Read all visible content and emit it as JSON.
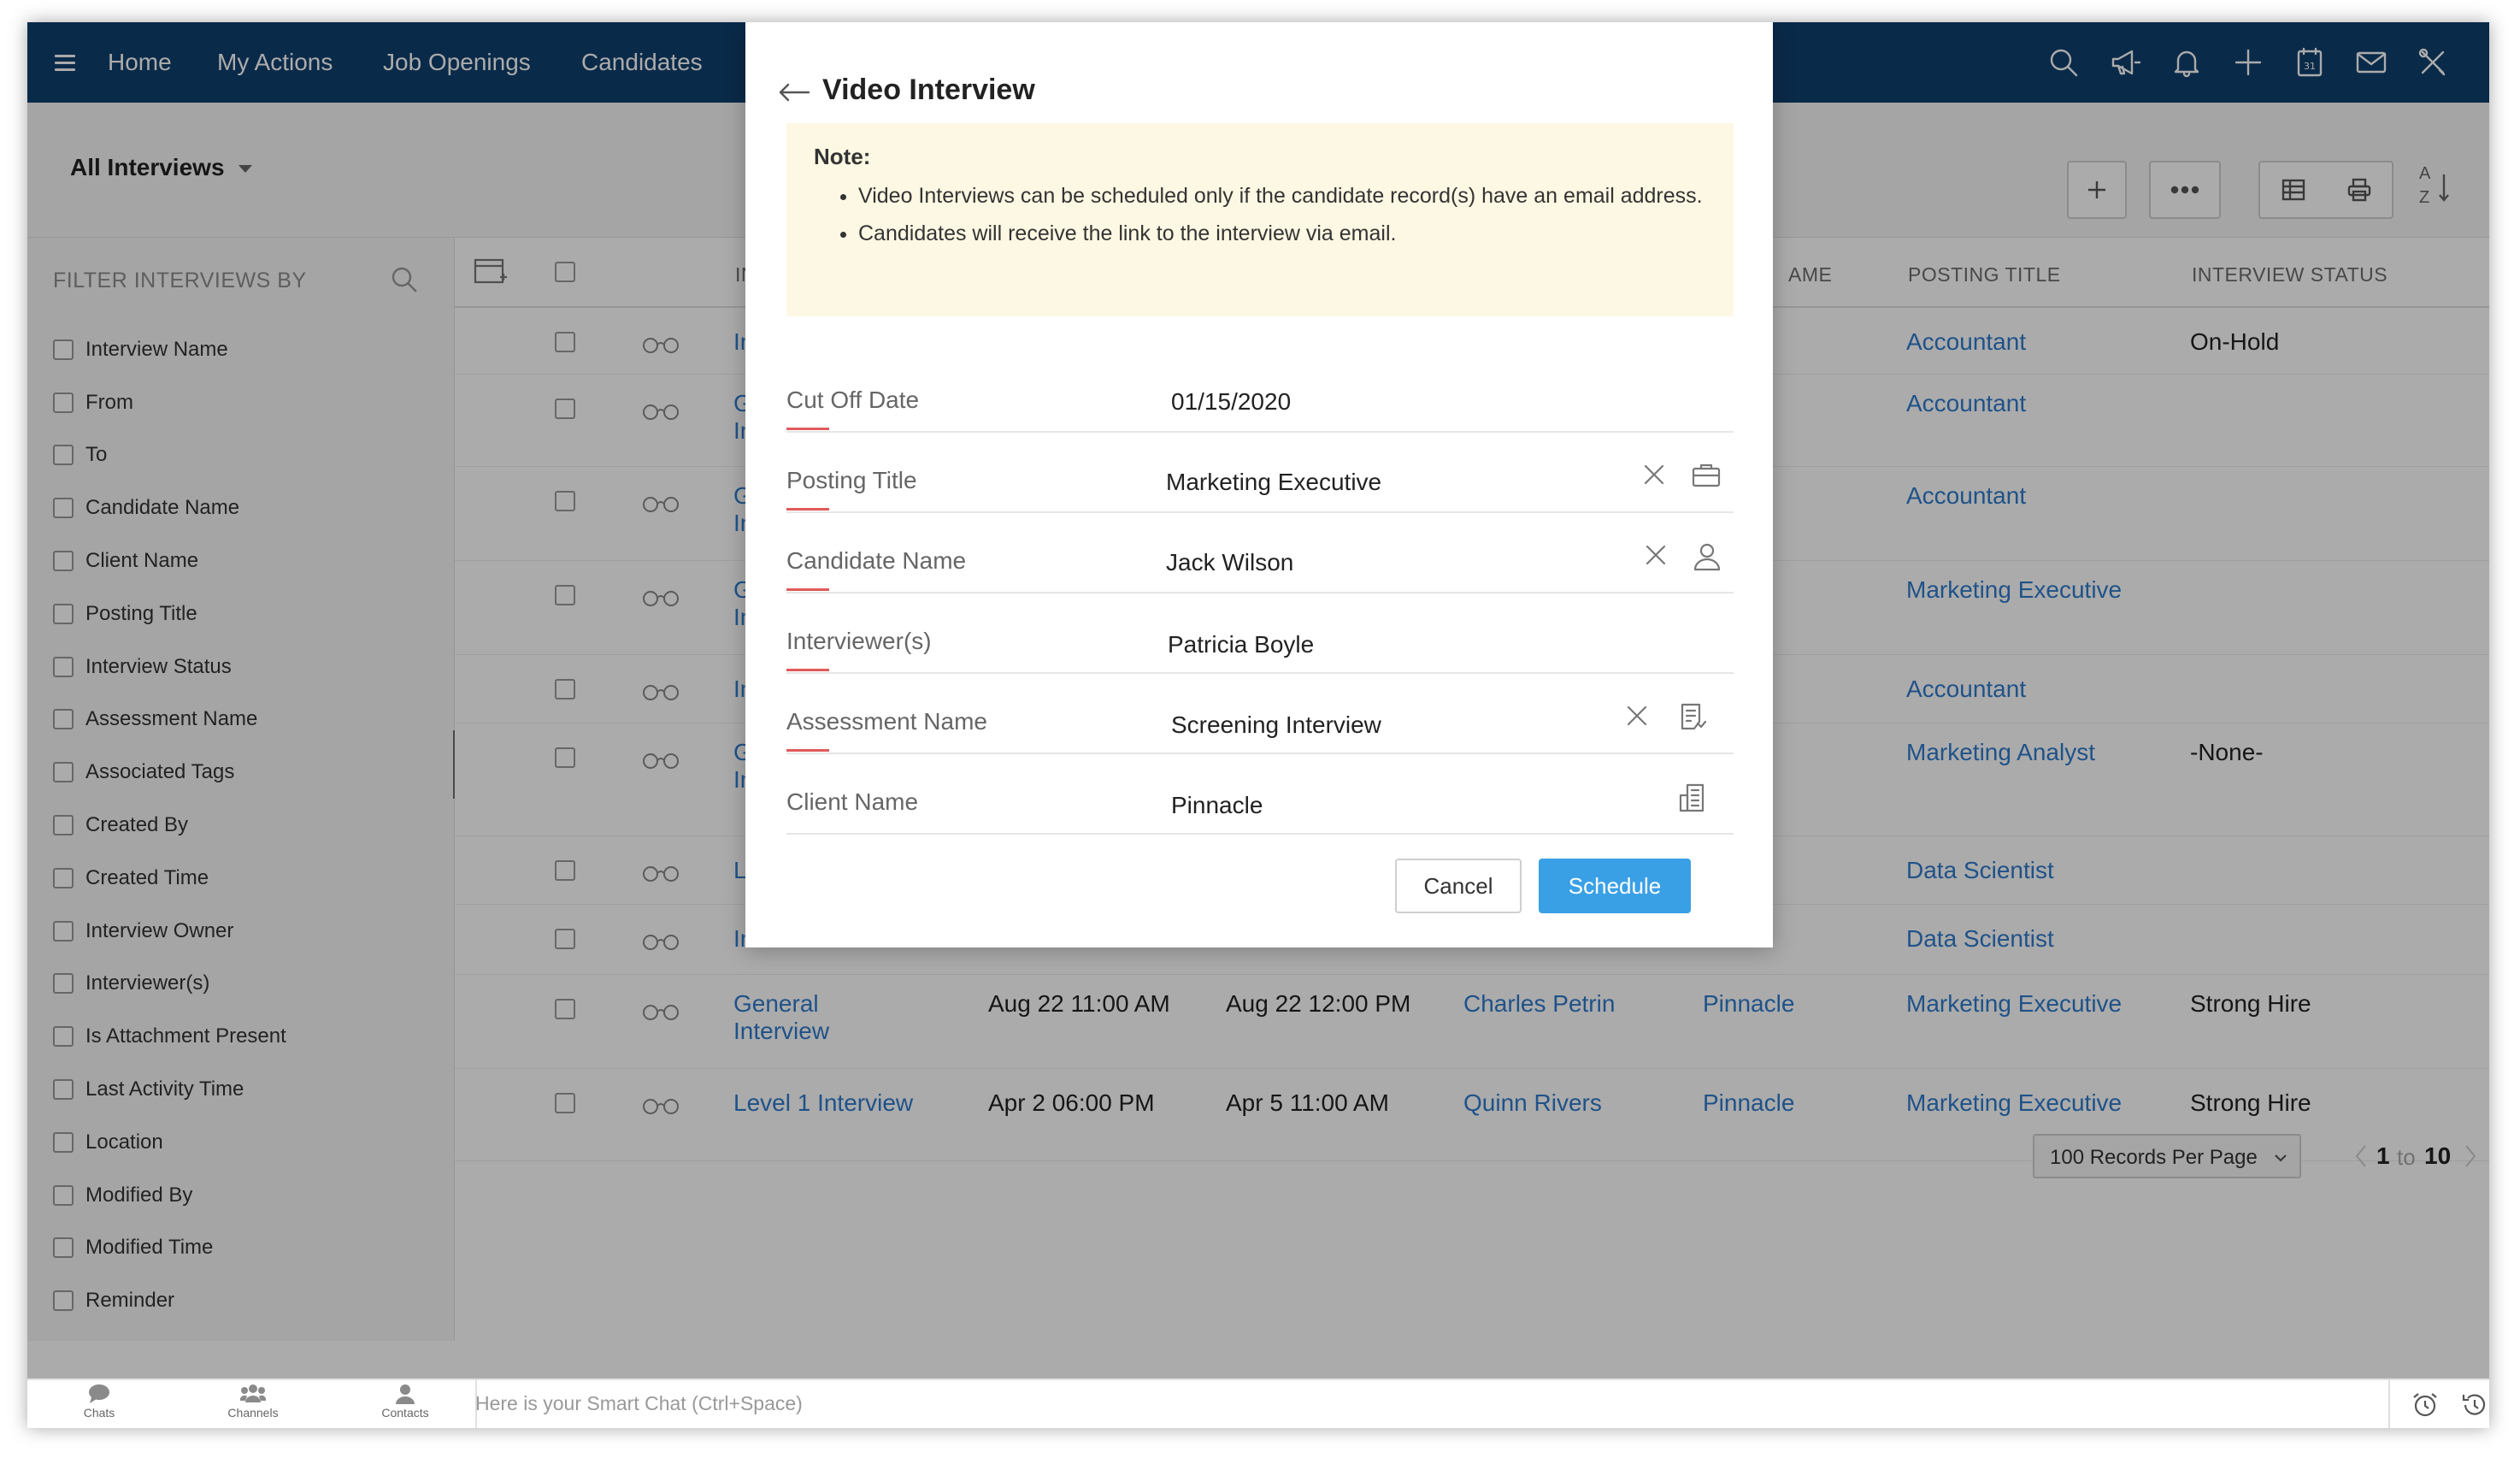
{
  "nav": {
    "tabs": [
      "Home",
      "My Actions",
      "Job Openings",
      "Candidates"
    ],
    "icons": [
      "search-icon",
      "megaphone-icon",
      "bell-icon",
      "plus-icon",
      "calendar-icon",
      "mail-icon",
      "tools-icon"
    ],
    "calendar_day": "31"
  },
  "toolbar": {
    "view": "All Interviews",
    "sort_top": "A",
    "sort_bottom": "Z"
  },
  "sidebar": {
    "title": "FILTER INTERVIEWS BY",
    "filters": [
      "Interview Name",
      "From",
      "To",
      "Candidate Name",
      "Client Name",
      "Posting Title",
      "Interview Status",
      "Assessment Name",
      "Associated Tags",
      "Created By",
      "Created Time",
      "Interview Owner",
      "Interviewer(s)",
      "Is Attachment Present",
      "Last Activity Time",
      "Location",
      "Modified By",
      "Modified Time",
      "Reminder"
    ]
  },
  "table": {
    "headers": {
      "interview": "INTE",
      "client": "AME",
      "posting": "POSTING TITLE",
      "status": "INTERVIEW STATUS"
    },
    "rows": [
      {
        "name1": "Inte",
        "name2": "",
        "posting": "Accountant",
        "status": "On-Hold"
      },
      {
        "name1": "Ger",
        "name2": "Inte",
        "posting": "Accountant",
        "status": ""
      },
      {
        "name1": "Ger",
        "name2": "Inte",
        "posting": "Accountant",
        "status": ""
      },
      {
        "name1": "Ger",
        "name2": "Inte",
        "posting": "Marketing Executive",
        "status": ""
      },
      {
        "name1": "Inte",
        "name2": "",
        "posting": "Accountant",
        "status": ""
      },
      {
        "name1": "Ger",
        "name2": "Inte",
        "posting": "Marketing Analyst",
        "status": "-None-"
      },
      {
        "name1": "Lev",
        "name2": "",
        "posting": "Data Scientist",
        "status": ""
      },
      {
        "name1": "Inte",
        "name2": "",
        "posting": "Data Scientist",
        "status": ""
      },
      {
        "name1": "General",
        "name2": "Interview",
        "from": "Aug 22 11:00 AM",
        "to": "Aug 22 12:00 PM",
        "candidate": "Charles Petrin",
        "client": "Pinnacle",
        "posting": "Marketing Executive",
        "status": "Strong Hire"
      },
      {
        "name1": "Level 1 Interview",
        "name2": "",
        "from": "Apr 2 06:00 PM",
        "to": "Apr 5 11:00 AM",
        "candidate": "Quinn Rivers",
        "client": "Pinnacle",
        "posting": "Marketing Executive",
        "status": "Strong Hire"
      }
    ],
    "per_page": "100 Records Per Page",
    "page_from": "1",
    "page_sep": "to",
    "page_to": "10"
  },
  "chatbar": {
    "chats": "Chats",
    "channels": "Channels",
    "contacts": "Contacts",
    "smart_chat": "Here is your Smart Chat (Ctrl+Space)"
  },
  "modal": {
    "title": "Video Interview",
    "note_head": "Note:",
    "note_items": [
      "Video Interviews can be scheduled only if the candidate record(s) have an email address.",
      "Candidates will receive the link to the interview via email."
    ],
    "fields": [
      {
        "label": "Cut Off Date",
        "value": "01/15/2020"
      },
      {
        "label": "Posting Title",
        "value": "Marketing Executive"
      },
      {
        "label": "Candidate Name",
        "value": "Jack Wilson"
      },
      {
        "label": "Interviewer(s)",
        "value": "Patricia Boyle"
      },
      {
        "label": "Assessment Name",
        "value": "Screening Interview"
      },
      {
        "label": "Client Name",
        "value": "Pinnacle"
      }
    ],
    "cancel": "Cancel",
    "schedule": "Schedule"
  },
  "colors": {
    "nav_bg": "#0f3f6e",
    "link": "#2f7bcc",
    "primary_button": "#3aa0e6",
    "note_bg": "#fdf8e3",
    "field_underline": "#e05a5a"
  }
}
